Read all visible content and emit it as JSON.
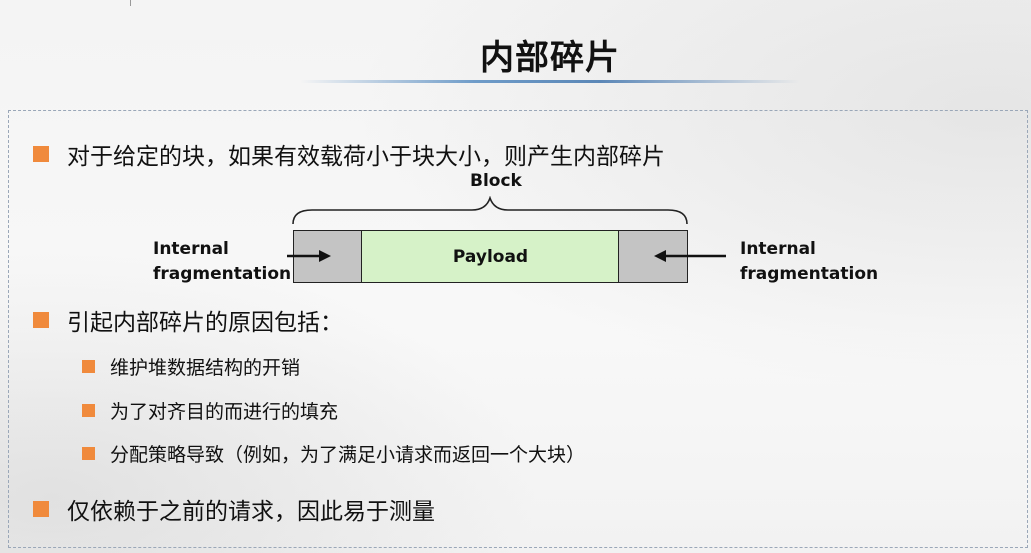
{
  "slide": {
    "title": "内部碎片"
  },
  "bullets": {
    "b1": "对于给定的块，如果有效载荷小于块大小，则产生内部碎片",
    "b2": "引起内部碎片的原因包括：",
    "b2_items": [
      "维护堆数据结构的开销",
      "为了对齐目的而进行的填充",
      "分配策略导致（例如，为了满足小请求而返回一个大块）"
    ],
    "b3": "仅依赖于之前的请求，因此易于测量"
  },
  "diagram": {
    "block_label": "Block",
    "payload_label": "Payload",
    "left_label": [
      "Internal",
      "fragmentation"
    ],
    "right_label": [
      "Internal",
      "fragmentation"
    ]
  },
  "colors": {
    "bullet": "#f08a3c",
    "payload_fill": "#d6f2c8",
    "fragment_fill": "#c4c4c4",
    "title_underline": "#5b87b7"
  }
}
